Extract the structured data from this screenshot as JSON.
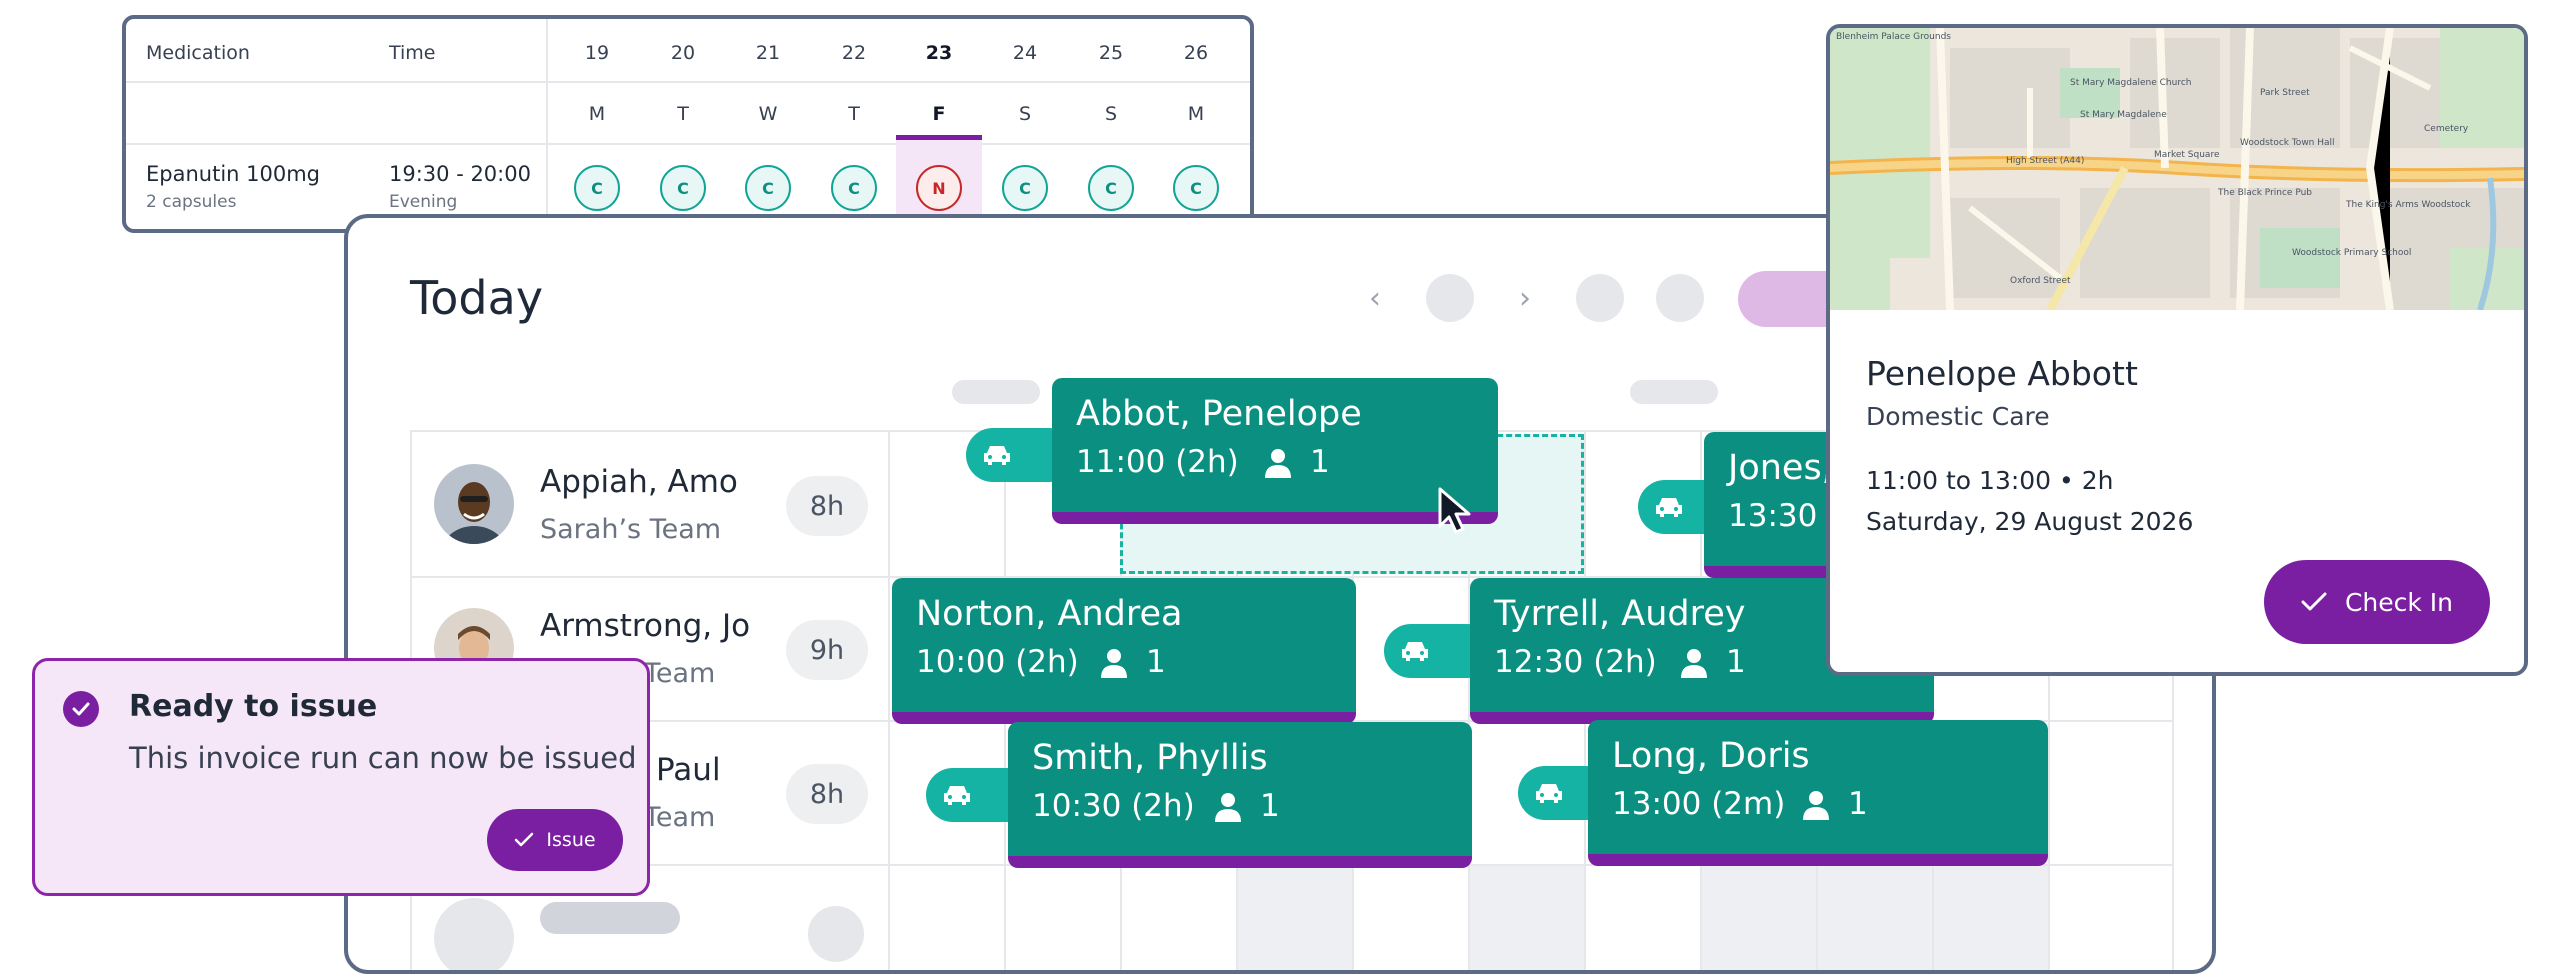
{
  "colors": {
    "brand_purple": "#7b1fa2",
    "visit_teal": "#0a8f80",
    "car_teal": "#14b3a3",
    "frame_slate": "#5b6b85",
    "completed_status": "#12a596",
    "not_taken_status": "#c62828"
  },
  "medication_chart": {
    "headers": {
      "medication": "Medication",
      "time": "Time"
    },
    "days": [
      {
        "num": "19",
        "letter": "M"
      },
      {
        "num": "20",
        "letter": "T"
      },
      {
        "num": "21",
        "letter": "W"
      },
      {
        "num": "22",
        "letter": "T"
      },
      {
        "num": "23",
        "letter": "F",
        "today": true
      },
      {
        "num": "24",
        "letter": "S"
      },
      {
        "num": "25",
        "letter": "S"
      },
      {
        "num": "26",
        "letter": "M"
      }
    ],
    "row": {
      "name": "Epanutin 100mg",
      "dose": "2 capsules",
      "time": "19:30 - 20:00",
      "period": "Evening",
      "statuses": [
        "C",
        "C",
        "C",
        "C",
        "N",
        "C",
        "C",
        "C"
      ]
    }
  },
  "scheduler": {
    "title": "Today",
    "icons": {
      "prev": "chevron-left-icon",
      "next": "chevron-right-icon",
      "travel": "car-icon",
      "person": "person-icon",
      "cursor": "mouse-pointer-icon"
    },
    "carers": [
      {
        "name": "Appiah, Amo",
        "team": "Sarah’s Team",
        "hours": "8h"
      },
      {
        "name": "Armstrong, Jo",
        "team": "Team",
        "hours": "9h"
      },
      {
        "name": "Paul",
        "team": "Team",
        "hours": "8h"
      }
    ],
    "visits": [
      {
        "client": "Abbot, Penelope",
        "time": "11:00 (2h)",
        "count": "1"
      },
      {
        "client": "Jones,",
        "time": "13:30",
        "count": ""
      },
      {
        "client": "Norton, Andrea",
        "time": "10:00 (2h)",
        "count": "1"
      },
      {
        "client": "Tyrrell, Audrey",
        "time": "12:30 (2h)",
        "count": "1"
      },
      {
        "client": "Smith, Phyllis",
        "time": "10:30 (2h)",
        "count": "1"
      },
      {
        "client": "Long, Doris",
        "time": "13:00 (2m)",
        "count": "1"
      }
    ]
  },
  "visit_detail": {
    "map_labels": [
      "Blenheim Palace Grounds",
      "St Mary Magdalene Church",
      "St Mary Magdalene",
      "Market Square",
      "High Street (A44)",
      "Woodstock Town Hall",
      "The Black Prince Pub",
      "Woodstock Primary School",
      "Cemetery",
      "The King's Arms Woodstock",
      "Oxford Street",
      "Park Street"
    ],
    "client_name": "Penelope Abbott",
    "care_type": "Domestic Care",
    "when": "11:00 to 13:00 • 2h",
    "date": "Saturday, 29 August 2026",
    "check_in_label": "Check In",
    "check_icon": "checkmark-icon"
  },
  "toast": {
    "title": "Ready to issue",
    "message": "This invoice run can now be issued",
    "button_label": "Issue",
    "icon": "check-circle-icon"
  }
}
